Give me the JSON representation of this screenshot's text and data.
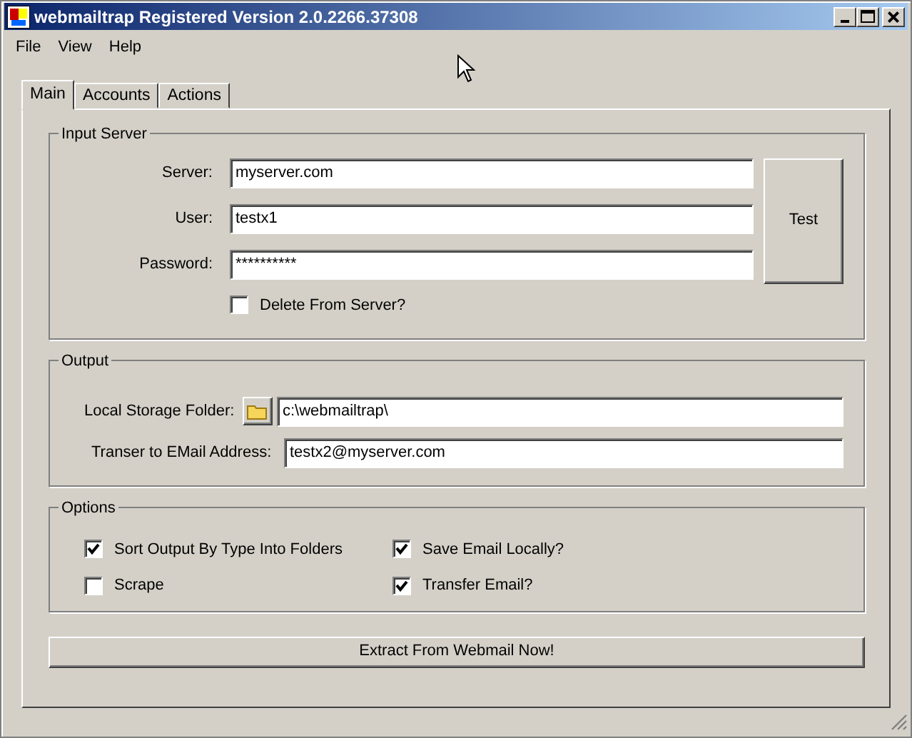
{
  "window": {
    "title": "webmailtrap Registered Version 2.0.2266.37308"
  },
  "menu": [
    "File",
    "View",
    "Help"
  ],
  "tabs": [
    {
      "label": "Main",
      "selected": true
    },
    {
      "label": "Accounts",
      "selected": false
    },
    {
      "label": "Actions",
      "selected": false
    }
  ],
  "input_server": {
    "title": "Input Server",
    "fields": [
      {
        "label": "Server:",
        "value": "myserver.com"
      },
      {
        "label": "User:",
        "value": "testx1"
      },
      {
        "label": "Password:",
        "value": "**********"
      }
    ],
    "test_button": "Test",
    "delete_from_server": {
      "label": "Delete From Server?",
      "checked": false
    }
  },
  "output": {
    "title": "Output",
    "folder": {
      "label": "Local Storage Folder:",
      "value": "c:\\webmailtrap\\"
    },
    "email": {
      "label": "Transer to EMail Address:",
      "value": "testx2@myserver.com"
    }
  },
  "options": {
    "title": "Options",
    "items": [
      {
        "label": "Sort Output By Type Into Folders",
        "checked": true
      },
      {
        "label": "Save Email Locally?",
        "checked": true
      },
      {
        "label": "Scrape",
        "checked": false
      },
      {
        "label": "Transfer Email?",
        "checked": true
      }
    ]
  },
  "extract_button": "Extract From Webmail Now!"
}
